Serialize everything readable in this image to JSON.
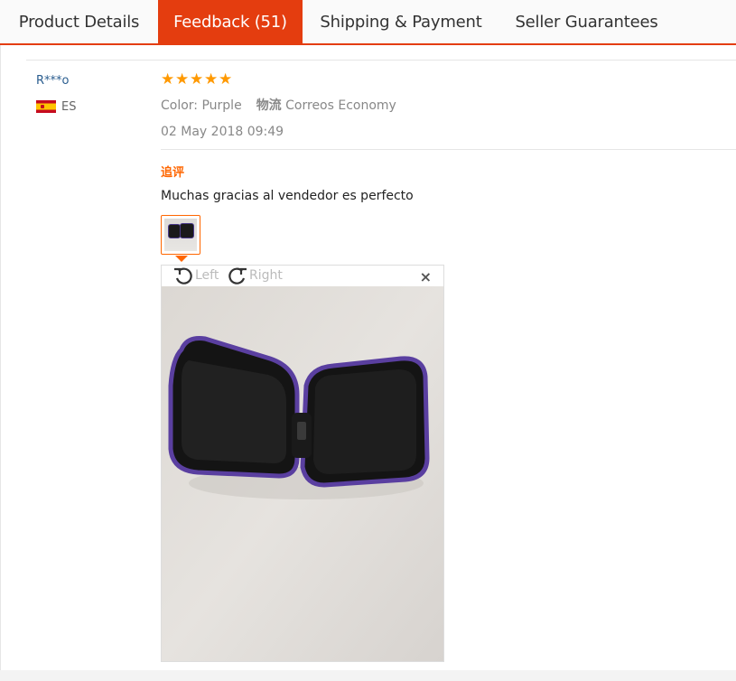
{
  "tabs": [
    {
      "label": "Product Details",
      "active": false
    },
    {
      "label": "Feedback (51)",
      "active": true
    },
    {
      "label": "Shipping & Payment",
      "active": false
    },
    {
      "label": "Seller Guarantees",
      "active": false
    }
  ],
  "review": {
    "user": "R***o",
    "country_code": "ES",
    "country_flag": "spain-flag",
    "rating": 5,
    "color_text": "Color: Purple",
    "logistics_label": "物流",
    "logistics_value": "Correos Economy",
    "date": "02 May 2018 09:49",
    "followup_label": "追评",
    "text": "Muchas gracias al vendedor es perfecto"
  },
  "viewer": {
    "rotate_left_label": "Left",
    "rotate_right_label": "Right",
    "close_symbol": "×"
  },
  "colors": {
    "accent": "#e43d0f",
    "star": "#ff9900",
    "followup": "#ff6600",
    "username": "#2a5d8f"
  }
}
